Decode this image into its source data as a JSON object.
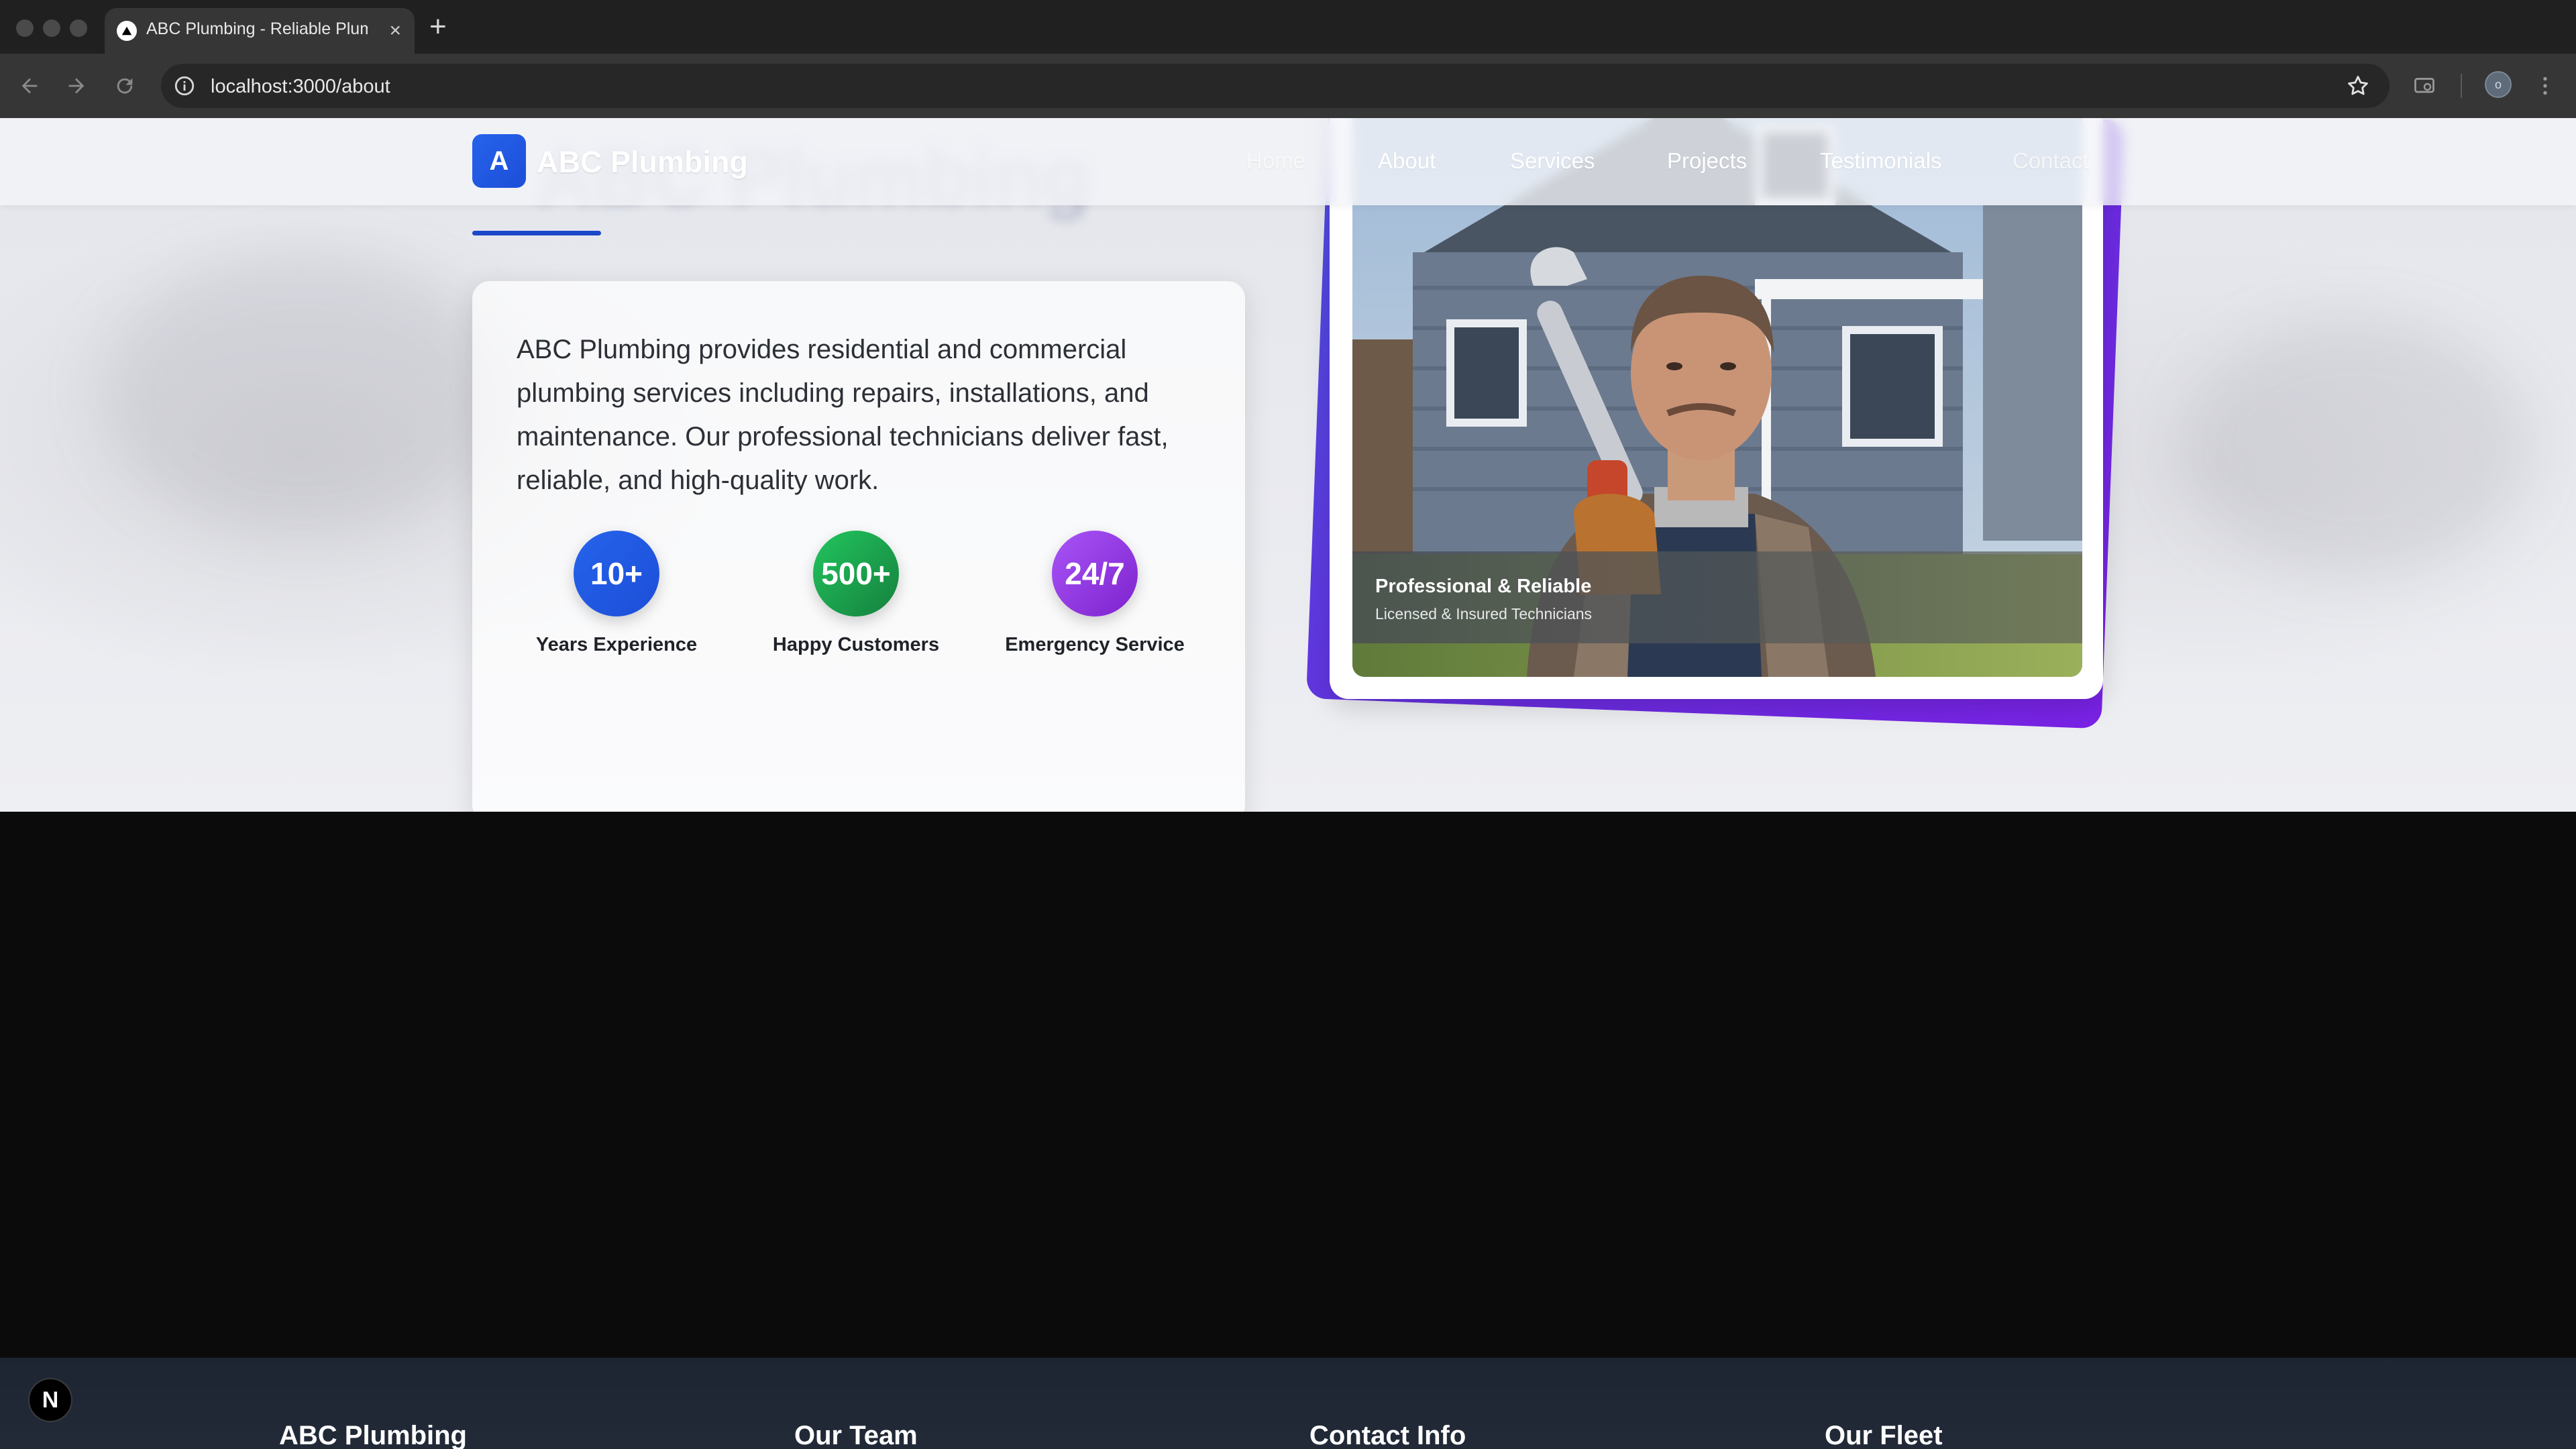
{
  "browser": {
    "tab_title": "ABC Plumbing - Reliable Plum",
    "url": "localhost:3000/about",
    "profile_initial": "o"
  },
  "navbar": {
    "logo_letter": "A",
    "brand": "ABC Plumbing",
    "links": [
      "Home",
      "About",
      "Services",
      "Projects",
      "Testimonials",
      "Contact"
    ]
  },
  "hero": {
    "ghost_title": "ABC Plumbing"
  },
  "about": {
    "text": "ABC Plumbing provides residential and commercial plumbing services including repairs, installations, and maintenance. Our professional technicians deliver fast, reliable, and high-quality work.",
    "stats": [
      {
        "value": "10+",
        "label": "Years Experience",
        "color": "#1d4ed8"
      },
      {
        "value": "500+",
        "label": "Happy Customers",
        "color": "#16a34a"
      },
      {
        "value": "24/7",
        "label": "Emergency Service",
        "color": "#9333ea"
      }
    ]
  },
  "image_card": {
    "caption_title": "Professional & Reliable",
    "caption_subtitle": "Licensed & Insured Technicians"
  },
  "footer": {
    "headings": [
      "ABC Plumbing",
      "Our Team",
      "Contact Info",
      "Our Fleet"
    ]
  },
  "dev_badge": "N",
  "colors": {
    "accent": "#1d4ed8",
    "accent_purple": "#6a2ce0"
  }
}
